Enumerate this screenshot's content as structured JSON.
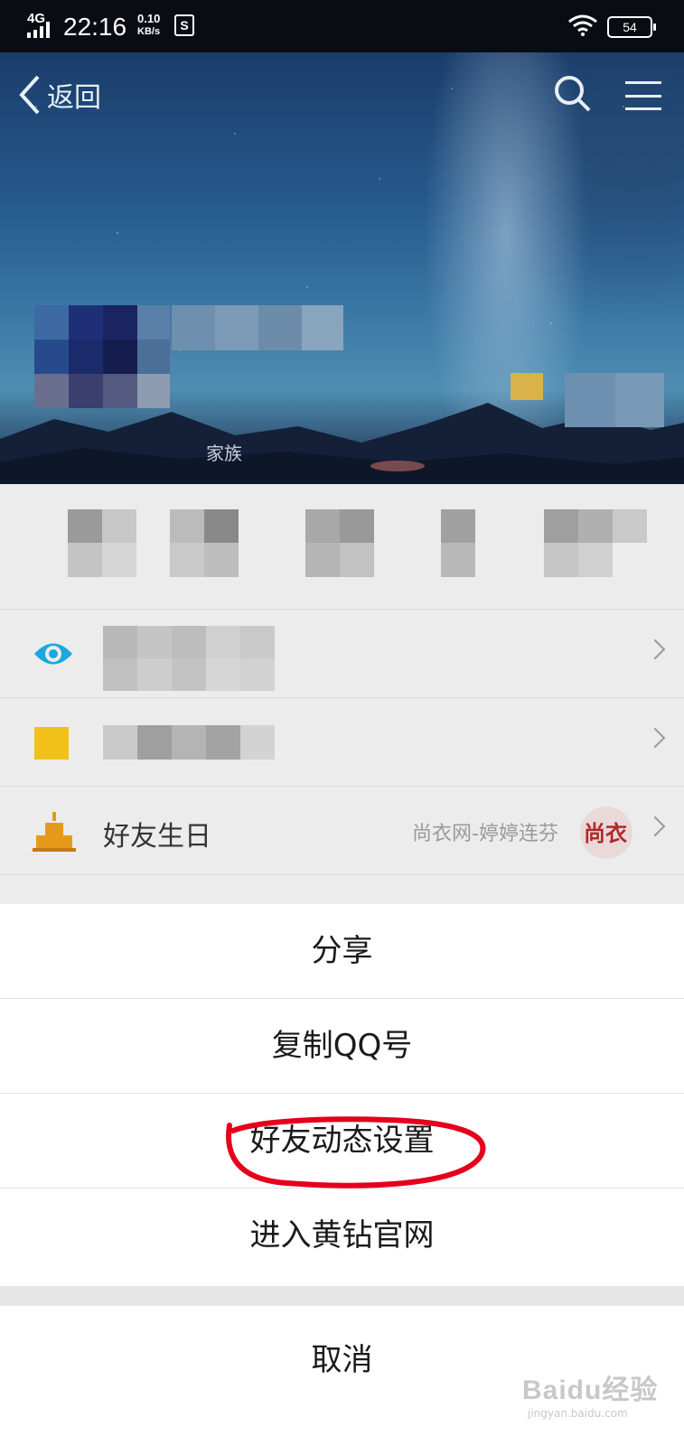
{
  "status_bar": {
    "network": "4G",
    "time": "22:16",
    "speed_value": "0.10",
    "speed_unit": "KB/s",
    "extra_icon_glyph": "S",
    "battery": "54"
  },
  "header": {
    "back_label": "返回",
    "icons": [
      "chevron-left-icon",
      "search-icon",
      "menu-icon"
    ]
  },
  "profile": {
    "family_tag": "家族"
  },
  "list": {
    "items": [
      {
        "icon": "eye-icon",
        "label": "",
        "sub": ""
      },
      {
        "icon": "square-icon",
        "label": "",
        "sub": ""
      },
      {
        "icon": "cake-icon",
        "label": "好友生日",
        "sub": "尚衣网-婷婷连芬",
        "thumb_text": "尚衣"
      }
    ]
  },
  "action_sheet": {
    "items": [
      "分享",
      "复制QQ号",
      "好友动态设置",
      "进入黄钻官网"
    ],
    "cancel": "取消",
    "highlighted_item": "好友动态设置"
  },
  "watermark": {
    "brand": "Baidu经验",
    "url": "jingyan.baidu.com"
  },
  "colors": {
    "eye_icon": "#1aa8e0",
    "square_icon": "#f1c11a",
    "cake_icon": "#e59a1c",
    "highlight_circle": "#e4001c"
  }
}
